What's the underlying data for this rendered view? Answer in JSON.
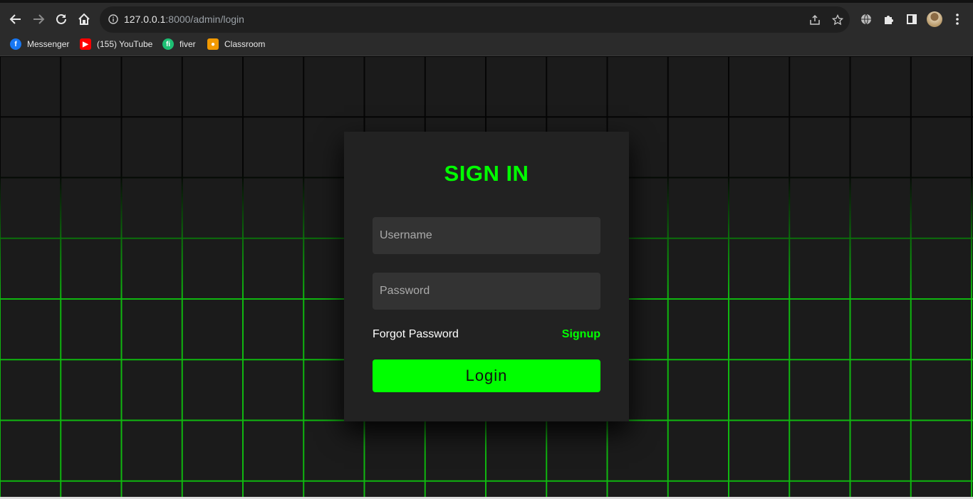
{
  "browser": {
    "url_host": "127.0.0.1",
    "url_path": ":8000/admin/login",
    "bookmarks": [
      {
        "label": "Messenger",
        "icon": "facebook-icon",
        "color": "#1877f2"
      },
      {
        "label": "(155) YouTube",
        "icon": "youtube-icon",
        "color": "#ff0000"
      },
      {
        "label": "fiver",
        "icon": "fiverr-icon",
        "color": "#1dbf73"
      },
      {
        "label": "Classroom",
        "icon": "classroom-icon",
        "color": "#f29900"
      }
    ]
  },
  "login": {
    "title": "SIGN IN",
    "username_placeholder": "Username",
    "password_placeholder": "Password",
    "forgot_label": "Forgot Password",
    "signup_label": "Signup",
    "login_label": "Login"
  },
  "colors": {
    "accent": "#00ff00",
    "card": "#222222",
    "input": "#333333"
  }
}
